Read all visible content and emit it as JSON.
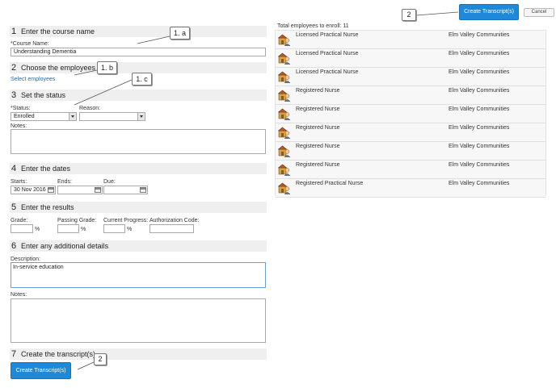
{
  "sections": {
    "s1": {
      "num": "1",
      "title": "Enter the course name"
    },
    "s2": {
      "num": "2",
      "title": "Choose the employees"
    },
    "s3": {
      "num": "3",
      "title": "Set the status"
    },
    "s4": {
      "num": "4",
      "title": "Enter the dates"
    },
    "s5": {
      "num": "5",
      "title": "Enter the results"
    },
    "s6": {
      "num": "6",
      "title": "Enter any additional details"
    },
    "s7": {
      "num": "7",
      "title": "Create the transcript(s)"
    }
  },
  "course": {
    "label": "*Course Name:",
    "value": "Understanding Dementia"
  },
  "employees_link": "Select employees",
  "status": {
    "status_label": "*Status:",
    "status_value": "Enrolled",
    "reason_label": "Reason:",
    "reason_value": "",
    "notes_label": "Notes:",
    "notes_value": ""
  },
  "dates": {
    "starts_label": "Starts:",
    "starts_value": "30 Nov 2016",
    "ends_label": "Ends:",
    "ends_value": "",
    "due_label": "Due:",
    "due_value": ""
  },
  "results": {
    "grade_label": "Grade:",
    "grade_value": "",
    "passing_label": "Passing Grade:",
    "passing_value": "",
    "progress_label": "Current Progress:",
    "progress_value": "",
    "auth_label": "Authorization Code:",
    "auth_value": "",
    "percent": "%"
  },
  "details": {
    "description_label": "Description:",
    "description_value": "In-service education",
    "notes_label": "Notes:",
    "notes_value": ""
  },
  "buttons": {
    "create_bottom": "Create Transcript(s)",
    "create_top": "Create Transcript(s)",
    "cancel": "Cancel"
  },
  "callouts": {
    "c1a": "1. a",
    "c1b": "1. b",
    "c1c": "1. c",
    "c2top": "2",
    "c2bottom": "2"
  },
  "enroll": {
    "total_label": "Total employees to enroll: 11",
    "employees": [
      {
        "title": "Licensed Practical Nurse",
        "org": "Elm Valley Communities"
      },
      {
        "title": "Licensed Practical Nurse",
        "org": "Elm Valley Communities"
      },
      {
        "title": "Licensed Practical Nurse",
        "org": "Elm Valley Communities"
      },
      {
        "title": "Registered Nurse",
        "org": "Elm Valley Communities"
      },
      {
        "title": "Registered Nurse",
        "org": "Elm Valley Communities"
      },
      {
        "title": "Registered Nurse",
        "org": "Elm Valley Communities"
      },
      {
        "title": "Registered Nurse",
        "org": "Elm Valley Communities"
      },
      {
        "title": "Registered Nurse",
        "org": "Elm Valley Communities"
      },
      {
        "title": "Registered Practical Nurse",
        "org": "Elm Valley Communities"
      }
    ]
  }
}
